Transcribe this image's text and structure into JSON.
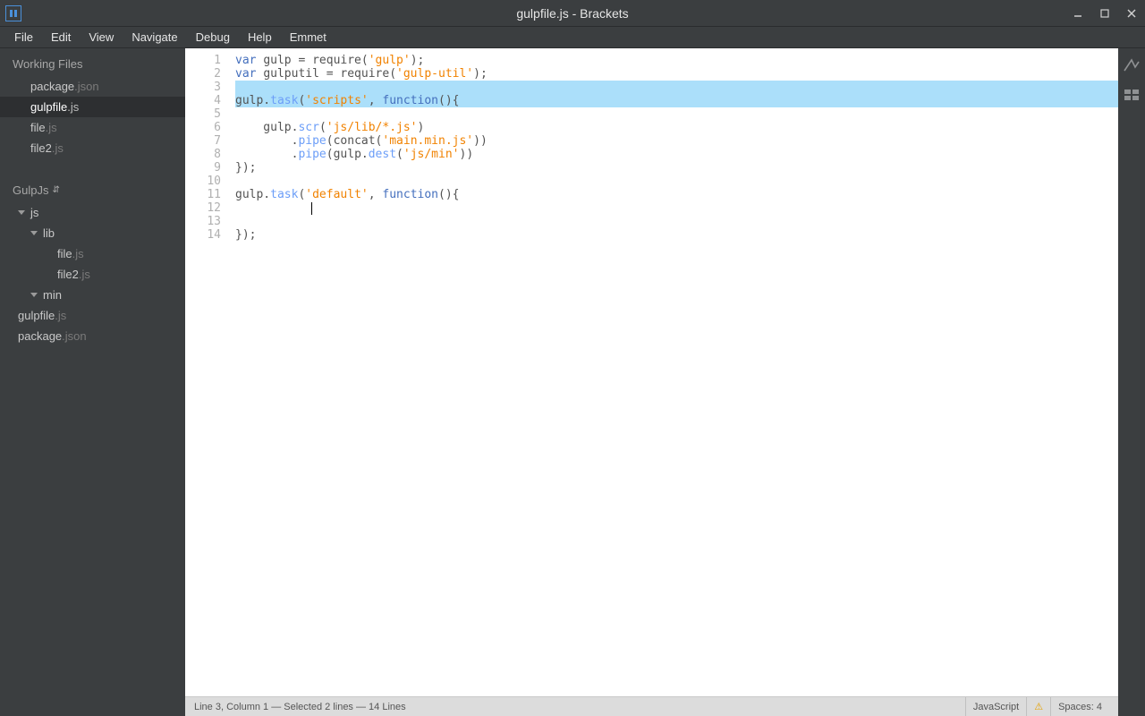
{
  "window": {
    "title": "gulpfile.js - Brackets"
  },
  "menu": [
    "File",
    "Edit",
    "View",
    "Navigate",
    "Debug",
    "Help",
    "Emmet"
  ],
  "sidebar": {
    "working_files_label": "Working Files",
    "working_files": [
      {
        "name": "package",
        "ext": ".json",
        "active": false
      },
      {
        "name": "gulpfile",
        "ext": ".js",
        "active": true
      },
      {
        "name": "file",
        "ext": ".js",
        "active": false
      },
      {
        "name": "file2",
        "ext": ".js",
        "active": false
      }
    ],
    "project_label": "GulpJs",
    "tree": [
      {
        "name": "js",
        "ext": "",
        "depth": 0,
        "folder": true
      },
      {
        "name": "lib",
        "ext": "",
        "depth": 1,
        "folder": true
      },
      {
        "name": "file",
        "ext": ".js",
        "depth": 3,
        "folder": false
      },
      {
        "name": "file2",
        "ext": ".js",
        "depth": 3,
        "folder": false
      },
      {
        "name": "min",
        "ext": "",
        "depth": 1,
        "folder": true
      },
      {
        "name": "gulpfile",
        "ext": ".js",
        "depth": 0,
        "folder": false
      },
      {
        "name": "package",
        "ext": ".json",
        "depth": 0,
        "folder": false
      }
    ]
  },
  "editor": {
    "lines": [
      [
        {
          "t": "var ",
          "c": "kw"
        },
        {
          "t": "gulp = require(",
          "c": ""
        },
        {
          "t": "'gulp'",
          "c": "str"
        },
        {
          "t": ");",
          "c": ""
        }
      ],
      [
        {
          "t": "var ",
          "c": "kw"
        },
        {
          "t": "gulputil = require(",
          "c": ""
        },
        {
          "t": "'gulp-util'",
          "c": "str"
        },
        {
          "t": ");",
          "c": ""
        }
      ],
      [
        {
          "t": "",
          "c": ""
        }
      ],
      [
        {
          "t": "gulp.",
          "c": ""
        },
        {
          "t": "task",
          "c": "call"
        },
        {
          "t": "(",
          "c": ""
        },
        {
          "t": "'scripts'",
          "c": "str"
        },
        {
          "t": ", ",
          "c": ""
        },
        {
          "t": "function",
          "c": "kw"
        },
        {
          "t": "(){",
          "c": ""
        }
      ],
      [
        {
          "t": "",
          "c": ""
        }
      ],
      [
        {
          "t": "    gulp.",
          "c": ""
        },
        {
          "t": "scr",
          "c": "call"
        },
        {
          "t": "(",
          "c": ""
        },
        {
          "t": "'js/lib/*.js'",
          "c": "str"
        },
        {
          "t": ")",
          "c": ""
        }
      ],
      [
        {
          "t": "        .",
          "c": ""
        },
        {
          "t": "pipe",
          "c": "call"
        },
        {
          "t": "(concat(",
          "c": ""
        },
        {
          "t": "'main.min.js'",
          "c": "str"
        },
        {
          "t": "))",
          "c": ""
        }
      ],
      [
        {
          "t": "        .",
          "c": ""
        },
        {
          "t": "pipe",
          "c": "call"
        },
        {
          "t": "(gulp.",
          "c": ""
        },
        {
          "t": "dest",
          "c": "call"
        },
        {
          "t": "(",
          "c": ""
        },
        {
          "t": "'js/min'",
          "c": "str"
        },
        {
          "t": "))",
          "c": ""
        }
      ],
      [
        {
          "t": "});",
          "c": ""
        }
      ],
      [
        {
          "t": "",
          "c": ""
        }
      ],
      [
        {
          "t": "gulp.",
          "c": ""
        },
        {
          "t": "task",
          "c": "call"
        },
        {
          "t": "(",
          "c": ""
        },
        {
          "t": "'default'",
          "c": "str"
        },
        {
          "t": ", ",
          "c": ""
        },
        {
          "t": "function",
          "c": "kw"
        },
        {
          "t": "(){",
          "c": ""
        }
      ],
      [
        {
          "t": "",
          "c": ""
        }
      ],
      [
        {
          "t": "",
          "c": ""
        }
      ],
      [
        {
          "t": "});",
          "c": ""
        }
      ]
    ],
    "selected_lines": [
      3,
      4
    ],
    "caret_line": 12,
    "caret_col": 11
  },
  "statusbar": {
    "cursor": "Line 3, Column 1 — Selected 2 lines — 14 Lines",
    "language": "JavaScript",
    "spaces": "Spaces: 4"
  }
}
